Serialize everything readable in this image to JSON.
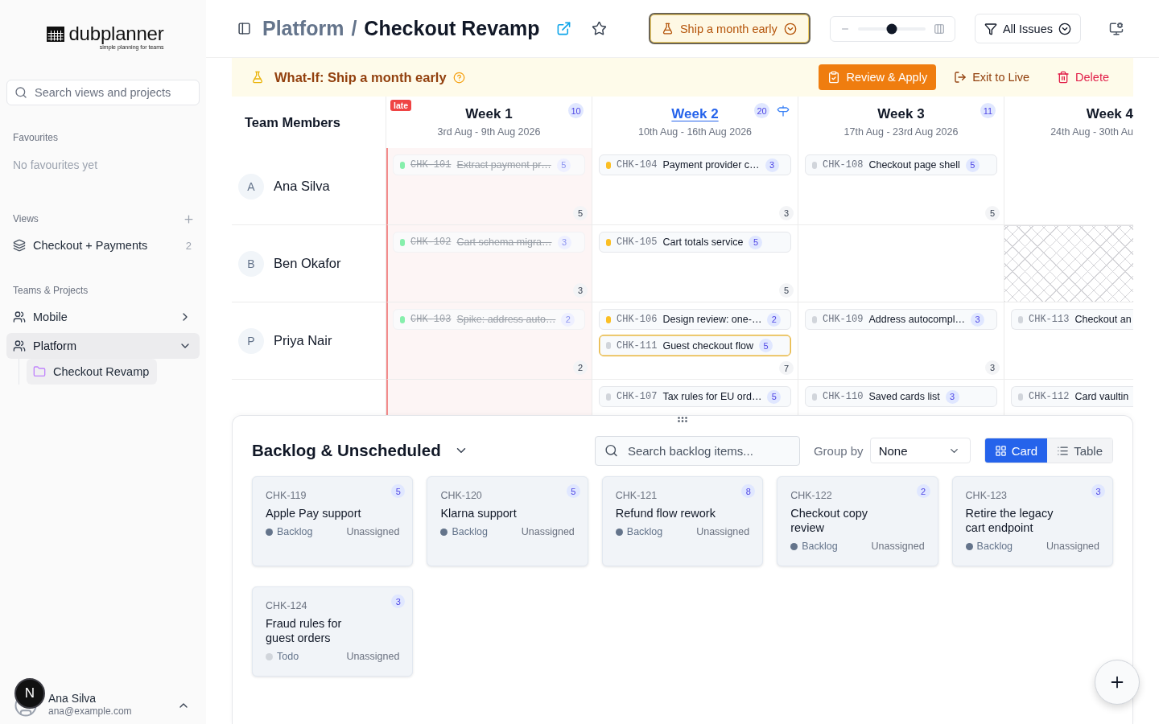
{
  "sidebar": {
    "logo": {
      "name": "dubplanner",
      "tagline": "simple planning for teams"
    },
    "search": {
      "placeholder": "Search views and projects"
    },
    "favourites": {
      "label": "Favourites",
      "empty_text": "No favourites yet"
    },
    "views": {
      "label": "Views",
      "items": [
        {
          "name": "Checkout + Payments",
          "count": "2",
          "selected": false
        }
      ]
    },
    "teams": {
      "label": "Teams & Projects",
      "items": [
        {
          "name": "Mobile",
          "expanded": false,
          "selected": false
        },
        {
          "name": "Platform",
          "expanded": true,
          "selected": true,
          "children": [
            {
              "name": "Checkout Revamp",
              "selected": true
            }
          ]
        }
      ]
    },
    "user": {
      "name": "Ana Silva",
      "email": "ana@example.com"
    },
    "dev_badge": {
      "label": "N"
    }
  },
  "header": {
    "breadcrumb": {
      "parent": "Platform",
      "separator": "/",
      "current": "Checkout Revamp"
    },
    "starred": false,
    "scenario": {
      "label": "Ship a month early"
    },
    "zoom": {
      "level": 0.5
    },
    "filter": {
      "label": "All Issues"
    }
  },
  "banner": {
    "title": "What-If: Ship a month early",
    "actions": [
      {
        "kind": "primary",
        "label": "Review & Apply"
      },
      {
        "kind": "exit",
        "label": "Exit to Live"
      },
      {
        "kind": "danger",
        "label": "Delete"
      }
    ]
  },
  "grid": {
    "corner": "Team Members",
    "weeks": [
      {
        "title": "Week 1",
        "dates": "3rd Aug - 9th Aug 2026",
        "points": "10",
        "badge": "late",
        "late": true,
        "current": false
      },
      {
        "title": "Week 2",
        "dates": "10th Aug - 16th Aug 2026",
        "points": "20",
        "late": false,
        "current": true
      },
      {
        "title": "Week 3",
        "dates": "17th Aug - 23rd Aug 2026",
        "points": "11",
        "late": false,
        "current": false
      },
      {
        "title": "Week 4",
        "dates": "24th Aug - 30th Au",
        "late": false,
        "current": false
      }
    ],
    "rows": [
      {
        "member": {
          "initial": "A",
          "name": "Ana Silva"
        },
        "cells": [
          {
            "total": "5",
            "unavailable": false,
            "cards": [
              {
                "id": "CHK-101",
                "title": "Extract payment pr…",
                "points": "5",
                "color": "#86efac",
                "done": true,
                "highlighted": false
              }
            ]
          },
          {
            "total": "3",
            "unavailable": false,
            "cards": [
              {
                "id": "CHK-104",
                "title": "Payment provider c…",
                "points": "3",
                "color": "#fbbf24",
                "done": false,
                "highlighted": false
              }
            ]
          },
          {
            "total": "5",
            "unavailable": false,
            "cards": [
              {
                "id": "CHK-108",
                "title": "Checkout page shell",
                "points": "5",
                "color": "#d1d5db",
                "done": false,
                "highlighted": false
              }
            ]
          },
          {
            "unavailable": false
          }
        ]
      },
      {
        "member": {
          "initial": "B",
          "name": "Ben Okafor"
        },
        "cells": [
          {
            "total": "3",
            "unavailable": false,
            "cards": [
              {
                "id": "CHK-102",
                "title": "Cart schema migra…",
                "points": "3",
                "color": "#86efac",
                "done": true,
                "highlighted": false
              }
            ]
          },
          {
            "total": "5",
            "unavailable": false,
            "cards": [
              {
                "id": "CHK-105",
                "title": "Cart totals service",
                "points": "5",
                "color": "#fbbf24",
                "done": false,
                "highlighted": false
              }
            ]
          },
          {
            "unavailable": false
          },
          {
            "unavailable": true
          }
        ]
      },
      {
        "member": {
          "initial": "P",
          "name": "Priya Nair"
        },
        "cells": [
          {
            "total": "2",
            "unavailable": false,
            "cards": [
              {
                "id": "CHK-103",
                "title": "Spike: address auto…",
                "points": "2",
                "color": "#86efac",
                "done": true,
                "highlighted": false
              }
            ]
          },
          {
            "total": "7",
            "unavailable": false,
            "cards": [
              {
                "id": "CHK-106",
                "title": "Design review: one-…",
                "points": "2",
                "color": "#fbbf24",
                "done": false,
                "highlighted": false
              },
              {
                "id": "CHK-111",
                "title": "Guest checkout flow",
                "points": "5",
                "color": "#d1d5db",
                "done": false,
                "highlighted": true
              }
            ]
          },
          {
            "total": "3",
            "unavailable": false,
            "cards": [
              {
                "id": "CHK-109",
                "title": "Address autocompl…",
                "points": "3",
                "color": "#d1d5db",
                "done": false,
                "highlighted": false
              }
            ]
          },
          {
            "unavailable": false,
            "cards": [
              {
                "id": "CHK-113",
                "title": "Checkout an",
                "color": "#d1d5db",
                "done": false,
                "highlighted": false
              }
            ]
          }
        ]
      },
      {
        "cells": [
          {
            "unavailable": false
          },
          {
            "unavailable": false,
            "cards": [
              {
                "id": "CHK-107",
                "title": "Tax rules for EU ord…",
                "points": "5",
                "color": "#d1d5db",
                "done": false,
                "highlighted": false
              }
            ]
          },
          {
            "unavailable": false,
            "cards": [
              {
                "id": "CHK-110",
                "title": "Saved cards list",
                "points": "3",
                "color": "#d1d5db",
                "done": false,
                "highlighted": false
              }
            ]
          },
          {
            "unavailable": false,
            "cards": [
              {
                "id": "CHK-112",
                "title": "Card vaultin",
                "color": "#d1d5db",
                "done": false,
                "highlighted": false
              }
            ]
          }
        ]
      }
    ]
  },
  "backlog": {
    "title": "Backlog & Unscheduled",
    "search": {
      "placeholder": "Search backlog items..."
    },
    "group_by": {
      "label": "Group by",
      "value": "None"
    },
    "view_toggle": [
      {
        "kind": "card",
        "label": "Card",
        "selected": true
      },
      {
        "kind": "table",
        "label": "Table",
        "selected": false
      }
    ],
    "items": [
      {
        "id": "CHK-119",
        "title": "Apple Pay support",
        "points": "5",
        "status": "Backlog",
        "color": "#64748b",
        "assignee": "Unassigned"
      },
      {
        "id": "CHK-120",
        "title": "Klarna support",
        "points": "5",
        "status": "Backlog",
        "color": "#64748b",
        "assignee": "Unassigned"
      },
      {
        "id": "CHK-121",
        "title": "Refund flow rework",
        "points": "8",
        "status": "Backlog",
        "color": "#64748b",
        "assignee": "Unassigned"
      },
      {
        "id": "CHK-122",
        "title": "Checkout copy review",
        "points": "2",
        "status": "Backlog",
        "color": "#64748b",
        "assignee": "Unassigned"
      },
      {
        "id": "CHK-123",
        "title": "Retire the legacy cart endpoint",
        "points": "3",
        "status": "Backlog",
        "color": "#64748b",
        "assignee": "Unassigned"
      },
      {
        "id": "CHK-124",
        "title": "Fraud rules for guest orders",
        "points": "3",
        "status": "Todo",
        "color": "#d1d5db",
        "assignee": "Unassigned"
      }
    ]
  }
}
